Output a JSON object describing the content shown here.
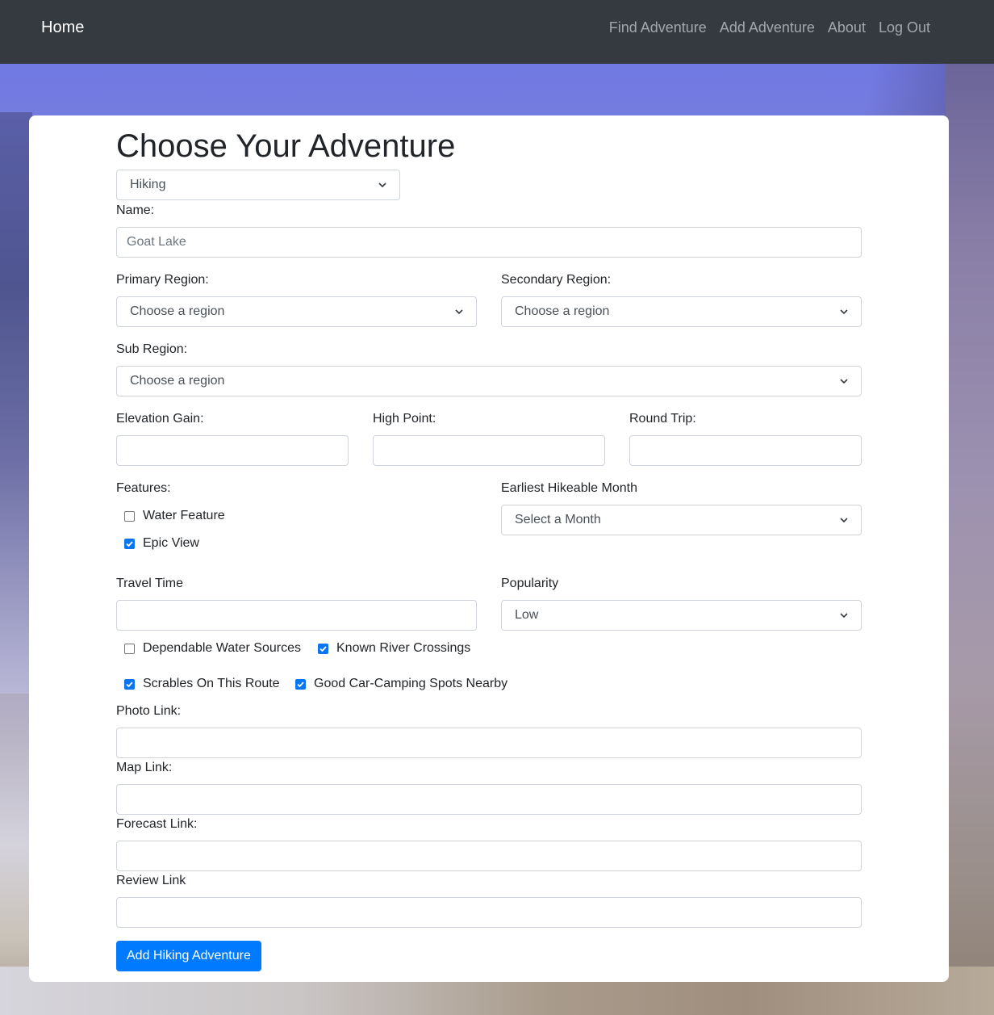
{
  "nav": {
    "brand": "Home",
    "links": [
      "Find Adventure",
      "Add Adventure",
      "About",
      "Log Out"
    ]
  },
  "form": {
    "title": "Choose Your Adventure",
    "activity": {
      "value": "Hiking"
    },
    "name": {
      "label": "Name:",
      "placeholder": "Goat Lake"
    },
    "primary_region": {
      "label": "Primary Region:",
      "value": "Choose a region"
    },
    "secondary_region": {
      "label": "Secondary Region:",
      "value": "Choose a region"
    },
    "sub_region": {
      "label": "Sub Region:",
      "value": "Choose a region"
    },
    "elevation_gain": {
      "label": "Elevation Gain:"
    },
    "high_point": {
      "label": "High Point:"
    },
    "round_trip": {
      "label": "Round Trip:"
    },
    "features": {
      "label": "Features:",
      "water_feature": {
        "label": "Water Feature",
        "checked": false
      },
      "epic_view": {
        "label": "Epic View",
        "checked": true
      }
    },
    "earliest_month": {
      "label": "Earliest Hikeable Month",
      "value": "Select a Month"
    },
    "travel_time": {
      "label": "Travel Time"
    },
    "popularity": {
      "label": "Popularity",
      "value": "Low"
    },
    "options": {
      "dependable_water": {
        "label": "Dependable Water Sources",
        "checked": false
      },
      "river_crossings": {
        "label": "Known River Crossings",
        "checked": true
      },
      "scrambles": {
        "label": "Scrables On This Route",
        "checked": true
      },
      "car_camping": {
        "label": "Good Car-Camping Spots Nearby",
        "checked": true
      }
    },
    "photo_link": {
      "label": "Photo Link:"
    },
    "map_link": {
      "label": "Map Link:"
    },
    "forecast_link": {
      "label": "Forecast Link:"
    },
    "review_link": {
      "label": "Review Link"
    },
    "submit_label": "Add Hiking Adventure"
  },
  "colors": {
    "navbar": "#343a40",
    "primary": "#007bff",
    "checkbox": "#0a75f0"
  }
}
